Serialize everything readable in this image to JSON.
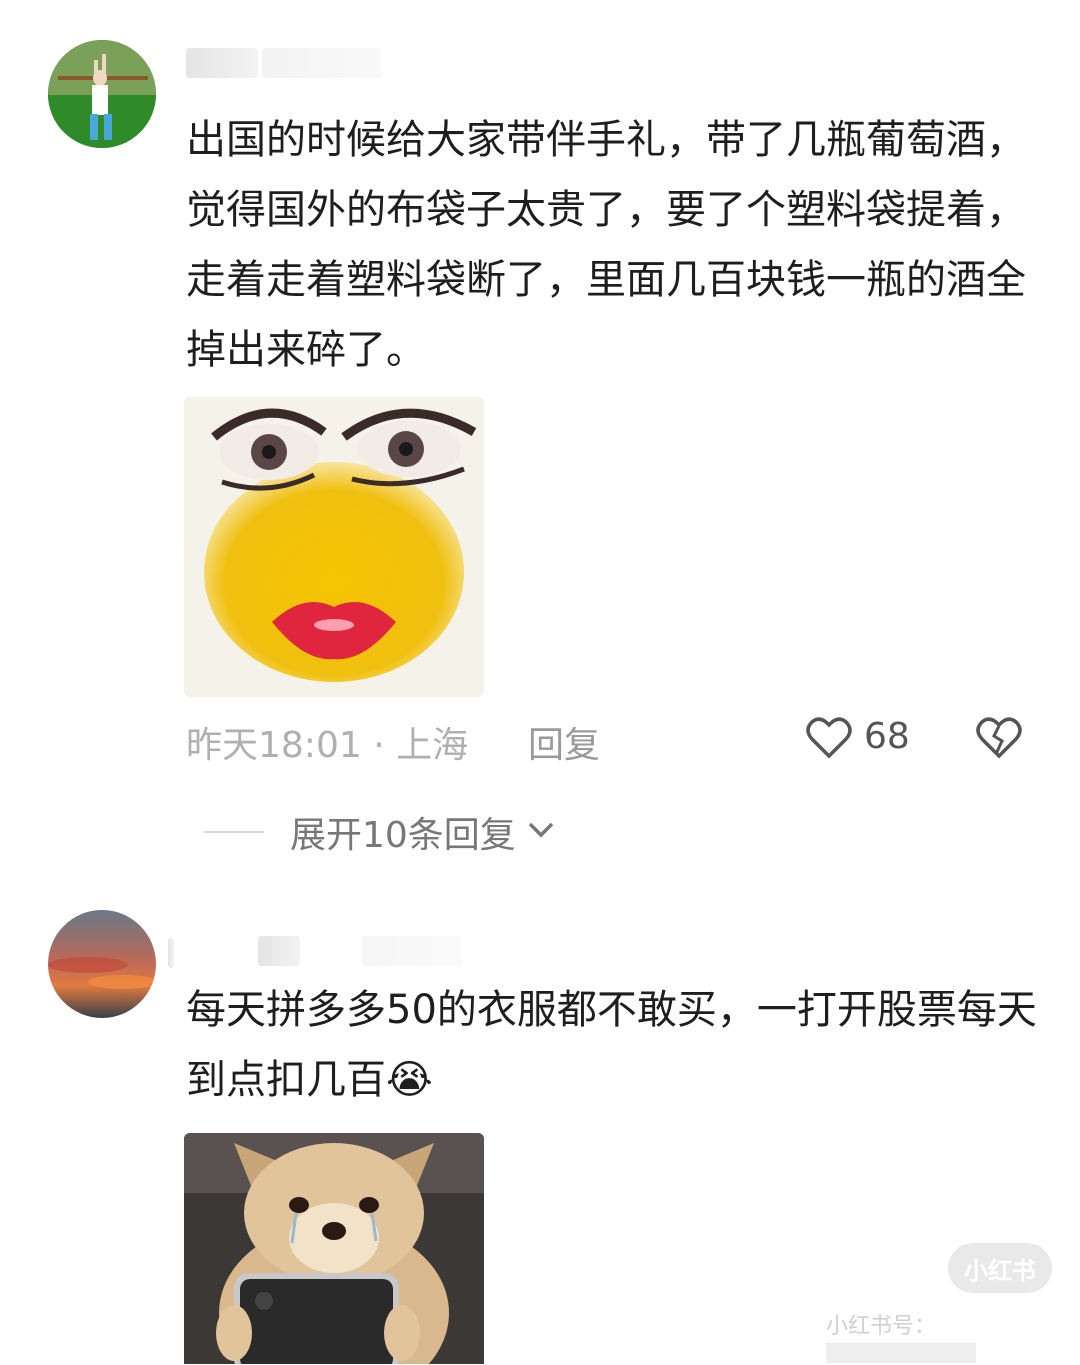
{
  "comments": [
    {
      "text": "出国的时候给大家带伴手礼，带了几瓶葡萄酒，觉得国外的布袋子太贵了，要了个塑料袋提着，走着走着塑料袋断了，里面几百块钱一瓶的酒全掉出来碎了。",
      "image_icon": "makeup-face-meme",
      "time_location": "昨天18:01 · 上海",
      "reply_label": "回复",
      "likes": "68",
      "expand_replies": "展开10条回复"
    },
    {
      "text": "每天拼多多50的衣服都不敢买，一打开股票每天到点扣几百😭",
      "image_icon": "crying-dog-phone-meme"
    }
  ],
  "watermark": {
    "badge": "小红书",
    "id_prefix": "小红书号："
  },
  "colors": {
    "background": "#ffffff",
    "meta_gray": "#b0b0b0",
    "text_dark": "#1e1e1e"
  }
}
